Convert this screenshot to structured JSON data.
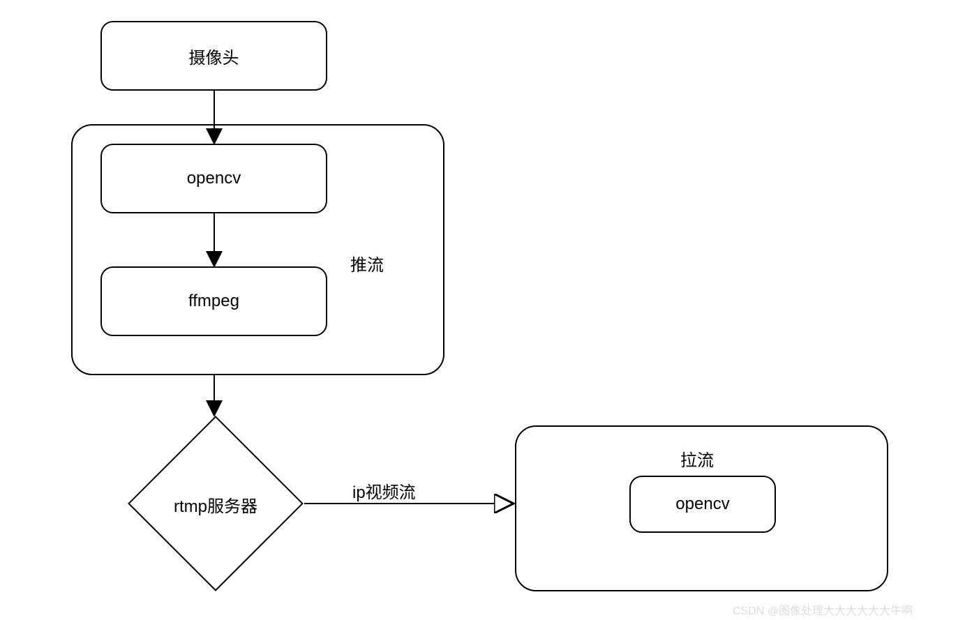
{
  "nodes": {
    "camera": "摄像头",
    "opencv_push": "opencv",
    "ffmpeg": "ffmpeg",
    "push_container": "推流",
    "rtmp": "rtmp服务器",
    "edge_ip": "ip视频流",
    "pull_container": "拉流",
    "opencv_pull": "opencv"
  },
  "watermark": "CSDN @图像处理大大大大大大牛啊"
}
